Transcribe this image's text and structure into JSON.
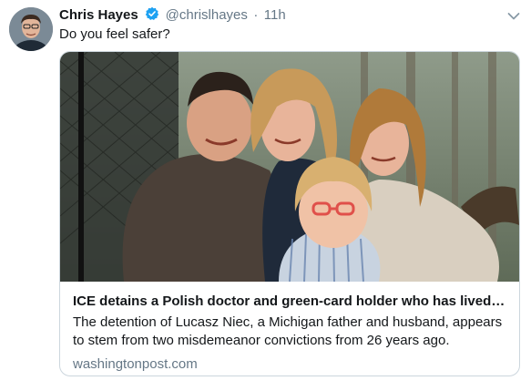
{
  "tweet": {
    "author_name": "Chris Hayes",
    "handle": "@chrislhayes",
    "separator": "·",
    "timestamp": "11h",
    "text": "Do you feel safer?",
    "verified": true
  },
  "card": {
    "title": "ICE detains a Polish doctor and green-card holder who has lived in th...",
    "description": "The detention of Lucasz Niec, a Michigan father and husband, appears to stem from two misdemeanor convictions from 26 years ago.",
    "domain": "washingtonpost.com",
    "image_subject": "family-photo"
  },
  "icons": {
    "verified": "verified-badge-icon",
    "menu": "chevron-down-icon"
  },
  "colors": {
    "text": "#14171a",
    "secondary": "#657786",
    "verified": "#1da1f2",
    "border": "#ccd6dd"
  }
}
